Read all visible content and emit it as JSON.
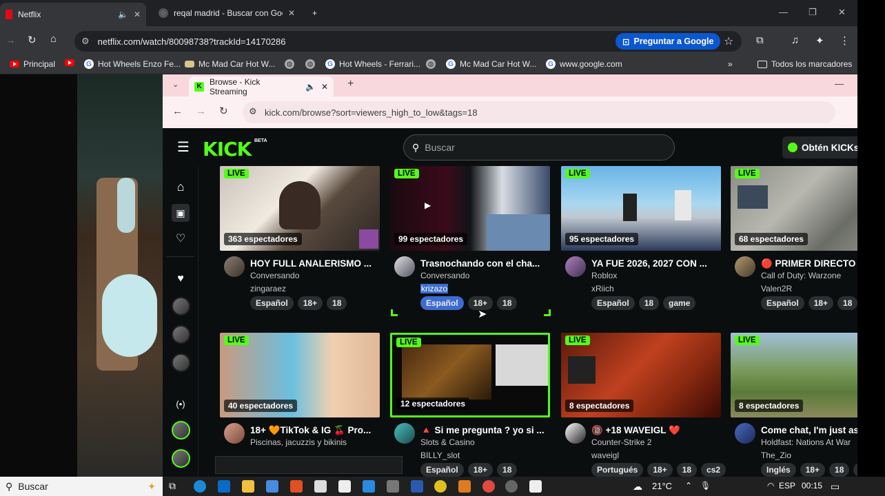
{
  "outer_browser": {
    "tabs": [
      {
        "label": "Netflix",
        "active": true
      },
      {
        "label": "reqal madrid - Buscar con Goo",
        "active": false
      }
    ],
    "new_tab": "+",
    "url": "netflix.com/watch/80098738?trackId=14170286",
    "ask_google": "Preguntar a Google",
    "bookmarks": [
      {
        "label": "Principal",
        "icon": "youtube-icon"
      },
      {
        "label": "",
        "icon": "youtube-icon"
      },
      {
        "label": "Hot Wheels Enzo Fe...",
        "icon": "google-icon"
      },
      {
        "label": "Mc Mad Car Hot W...",
        "icon": "site-icon"
      },
      {
        "label": "",
        "icon": "globe-icon"
      },
      {
        "label": "",
        "icon": "globe-icon"
      },
      {
        "label": "Hot Wheels - Ferrari...",
        "icon": "google-icon"
      },
      {
        "label": "",
        "icon": "globe-icon"
      },
      {
        "label": "Mc Mad Car Hot W...",
        "icon": "google-icon"
      },
      {
        "label": "www.google.com",
        "icon": "google-icon"
      }
    ],
    "all_bookmarks": "Todos los marcadores",
    "overflow": "»"
  },
  "inner_browser": {
    "tab_label": "Browse - Kick Streaming",
    "url": "kick.com/browse?sort=viewers_high_to_low&tags=18"
  },
  "kick": {
    "logo": "KICK",
    "beta": "BETA",
    "search_placeholder": "Buscar",
    "get_kicks": "Obtén KICKs",
    "brand_color": "#53fc18",
    "streams": [
      {
        "live": "LIVE",
        "viewers": "363 espectadores",
        "title": "HOY FULL ANALERISMO ...",
        "category": "Conversando",
        "user": "zingaraez",
        "tags": [
          "Español",
          "18+",
          "18"
        ]
      },
      {
        "live": "LIVE",
        "viewers": "99 espectadores",
        "title": "Trasnochando con el cha...",
        "category": "Conversando",
        "user": "krizazo",
        "tags": [
          "Español",
          "18+",
          "18"
        ]
      },
      {
        "live": "LIVE",
        "viewers": "95 espectadores",
        "title": "YA FUE 2026, 2027 CON ...",
        "category": "Roblox",
        "user": "xRiich",
        "tags": [
          "Español",
          "18",
          "game"
        ]
      },
      {
        "live": "LIVE",
        "viewers": "68 espectadores",
        "title": "🔴 PRIMER DIRECTO D",
        "category": "Call of Duty: Warzone",
        "user": "Valen2R",
        "tags": [
          "Español",
          "18+",
          "18"
        ]
      },
      {
        "live": "LIVE",
        "viewers": "40 espectadores",
        "title": "18+ 🧡TikTok & IG 🍒 Pro...",
        "category": "Piscinas, jacuzzis y bikinis",
        "user": "",
        "tags": []
      },
      {
        "live": "LIVE",
        "viewers": "12 espectadores",
        "title": "🔺 Si me pregunta ? yo si ...",
        "category": "Slots & Casino",
        "user": "BILLY_slot",
        "tags": [
          "Español",
          "18+",
          "18"
        ]
      },
      {
        "live": "LIVE",
        "viewers": "8 espectadores",
        "title": "🔞 +18 WAVEIGL ❤️",
        "category": "Counter-Strike 2",
        "user": "waveigl",
        "tags": [
          "Portugués",
          "18+",
          "18",
          "cs2"
        ]
      },
      {
        "live": "LIVE",
        "viewers": "8 espectadores",
        "title": "Come chat, I'm just as",
        "category": "Holdfast: Nations At War",
        "user": "The_Zio",
        "tags": [
          "Inglés",
          "18+",
          "18",
          "ch"
        ]
      }
    ]
  },
  "taskbar": {
    "search": "Buscar",
    "temperature": "21°C",
    "language": "ESP",
    "time": "00:15"
  }
}
